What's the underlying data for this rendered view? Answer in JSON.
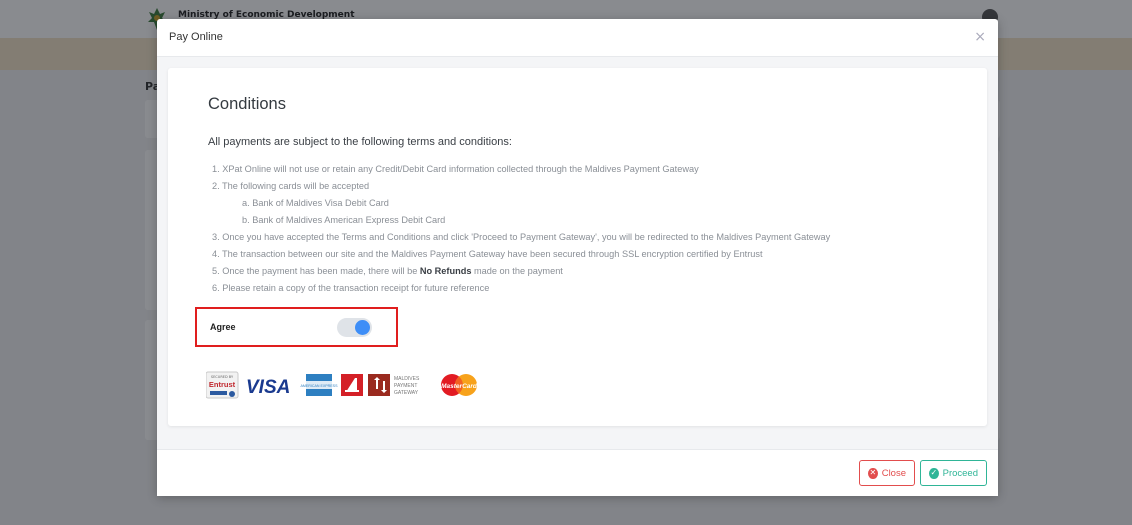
{
  "app": {
    "brand": "Ministry of Economic Development",
    "user_label": "",
    "page_title": "Pa"
  },
  "modal": {
    "title": "Pay Online",
    "close_glyph": "×",
    "conditions_title": "Conditions",
    "intro": "All payments are subject to the following terms and conditions:",
    "items": [
      {
        "text": "1. XPat Online will not use or retain any Credit/Debit Card information collected through the Maldives Payment Gateway"
      },
      {
        "text": "2. The following cards will be accepted"
      },
      {
        "text": "a. Bank of Maldives Visa Debit Card",
        "sub": true
      },
      {
        "text": "b. Bank of Maldives American Express Debit Card",
        "sub": true
      },
      {
        "text": "3. Once you have accepted the Terms and Conditions and click 'Proceed to Payment Gateway', you will be redirected to the Maldives Payment Gateway"
      },
      {
        "text": "4. The transaction between our site and the Maldives Payment Gateway have been secured through SSL encryption certified by Entrust"
      },
      {
        "text_before": "5. Once the payment has been made, there will be ",
        "bold": "No Refunds",
        "text_after": " made on the payment"
      },
      {
        "text": "6. Please retain a copy of the transaction receipt for future reference"
      }
    ],
    "agree": {
      "label": "Agree",
      "checked": true
    },
    "logos": {
      "entrust_top": "SECURED BY",
      "entrust": "Entrust",
      "visa": "VISA",
      "amex": "AMERICAN EXPRESS",
      "mpg_line1": "MALDIVES",
      "mpg_line2": "PAYMENT",
      "mpg_line3": "GATEWAY",
      "mastercard": "MasterCard"
    },
    "buttons": {
      "close_label": "Close",
      "proceed_label": "Proceed"
    }
  },
  "colors": {
    "accent_blue": "#3e8ef7",
    "danger": "#e24d4d",
    "success": "#2fb597",
    "highlight_border": "#e01e1e"
  }
}
